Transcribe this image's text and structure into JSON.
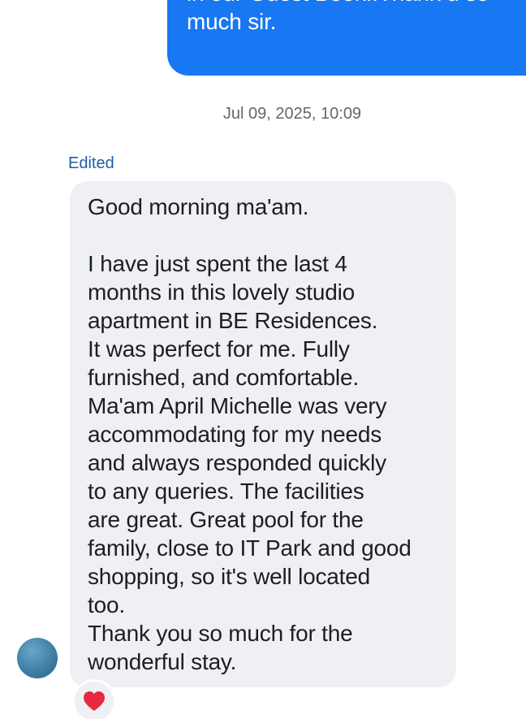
{
  "sent_message": {
    "text": "in our Guest Book..Thank u so\nmuch sir."
  },
  "timestamp": "Jul 09, 2025, 10:09",
  "received_message": {
    "edited_label": "Edited",
    "greeting": "Good morning ma'am.",
    "body": "I have just spent the last 4\nmonths in this lovely studio\napartment in BE Residences.\nIt was perfect for me. Fully\nfurnished, and comfortable.\nMa'am April Michelle was very\naccommodating for my needs\nand always responded quickly\nto any queries. The facilities\nare great. Great pool for the\nfamily, close to IT Park and good\nshopping, so it's well located\ntoo.\nThank you so much for the\nwonderful stay."
  },
  "reaction": {
    "icon": "heart-icon",
    "color": "#e8283f"
  },
  "colors": {
    "sent_bubble": "#1877f2",
    "received_bubble": "#eef0f4",
    "edited_label": "#1f5fa8",
    "timestamp": "#65676b"
  }
}
